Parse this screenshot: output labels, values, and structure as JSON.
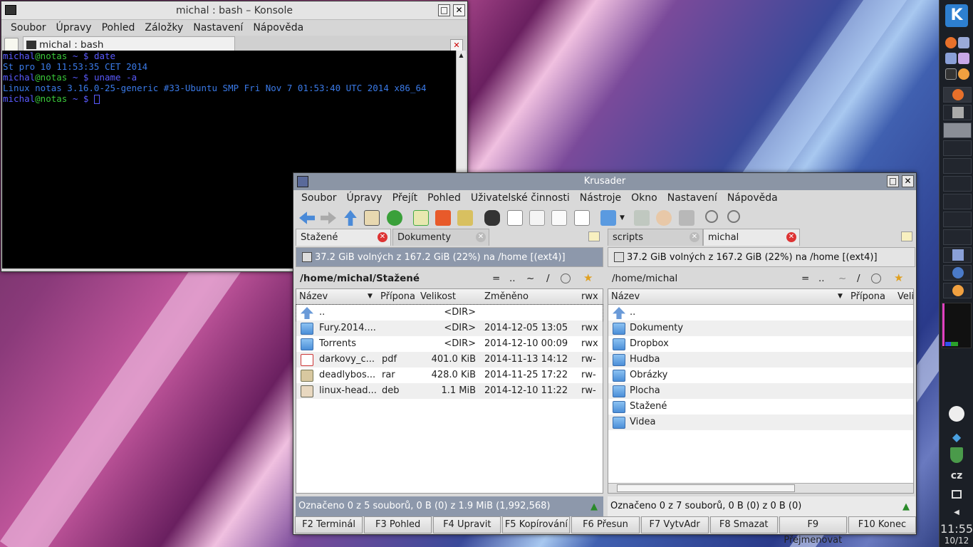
{
  "konsole": {
    "title": "michal : bash – Konsole",
    "menu": [
      "Soubor",
      "Úpravy",
      "Pohled",
      "Záložky",
      "Nastavení",
      "Nápověda"
    ],
    "tab": "michal : bash",
    "lines": [
      {
        "user": "michal",
        "host": "@notas",
        "rest": " ~ $ ",
        "cmd": "date"
      },
      {
        "out": "St pro 10 11:53:35 CET 2014"
      },
      {
        "user": "michal",
        "host": "@notas",
        "rest": " ~ $ ",
        "cmd": "uname -a"
      },
      {
        "out": "Linux notas 3.16.0-25-generic #33-Ubuntu SMP Fri Nov 7 01:53:40 UTC 2014 x86_64"
      },
      {
        "user": "michal",
        "host": "@notas",
        "rest": " ~ $ ",
        "cmd": ""
      }
    ]
  },
  "krusader": {
    "title": "Krusader",
    "menu": [
      "Soubor",
      "Úpravy",
      "Přejít",
      "Pohled",
      "Uživatelské činnosti",
      "Nástroje",
      "Okno",
      "Nastavení",
      "Nápověda"
    ],
    "left": {
      "tabs": [
        "Stažené",
        "Dokumenty"
      ],
      "space": "37.2 GiB volných z 167.2 GiB (22%) na /home [(ext4)]",
      "path": "/home/michal/Stažené",
      "path_buttons": [
        "=",
        "..",
        "~",
        "/"
      ],
      "headers": [
        "Název",
        "Přípona",
        "Velikost",
        "Změněno",
        "rwx"
      ],
      "rows": [
        {
          "name": "..",
          "ext": "",
          "size": "<DIR>",
          "date": "",
          "perm": "",
          "icon": "up"
        },
        {
          "name": "Fury.2014....",
          "ext": "",
          "size": "<DIR>",
          "date": "2014-12-05 13:05",
          "perm": "rwx",
          "icon": "folder"
        },
        {
          "name": "Torrents",
          "ext": "",
          "size": "<DIR>",
          "date": "2014-12-10 00:09",
          "perm": "rwx",
          "icon": "folder"
        },
        {
          "name": "darkovy_c...",
          "ext": "pdf",
          "size": "401.0 KiB",
          "date": "2014-11-13 14:12",
          "perm": "rw-",
          "icon": "pdf"
        },
        {
          "name": "deadlybos...",
          "ext": "rar",
          "size": "428.0 KiB",
          "date": "2014-11-25 17:22",
          "perm": "rw-",
          "icon": "rar"
        },
        {
          "name": "linux-head...",
          "ext": "deb",
          "size": "1.1 MiB",
          "date": "2014-12-10 11:22",
          "perm": "rw-",
          "icon": "deb"
        }
      ],
      "status": "Označeno 0 z 5 souborů, 0 B  (0) z 1.9 MiB (1,992,568)"
    },
    "right": {
      "tabs": [
        "scripts",
        "michal"
      ],
      "space": "37.2 GiB volných z 167.2 GiB (22%) na /home [(ext4)]",
      "path": "/home/michal",
      "path_buttons": [
        "=",
        "..",
        "~",
        "/"
      ],
      "headers": [
        "Název",
        "Přípona",
        "Veli"
      ],
      "rows": [
        {
          "name": "..",
          "icon": "up"
        },
        {
          "name": "Dokumenty",
          "icon": "folder"
        },
        {
          "name": "Dropbox",
          "icon": "folder"
        },
        {
          "name": "Hudba",
          "icon": "folder"
        },
        {
          "name": "Obrázky",
          "icon": "folder"
        },
        {
          "name": "Plocha",
          "icon": "folder"
        },
        {
          "name": "Stažené",
          "icon": "folder"
        },
        {
          "name": "Videa",
          "icon": "folder"
        }
      ],
      "status": "Označeno 0 z 7 souborů, 0 B  (0) z 0 B (0)"
    },
    "fkeys": [
      "F2 Terminál",
      "F3 Pohled",
      "F4 Upravit",
      "F5 Kopírování",
      "F6 Přesun",
      "F7 VytvAdr",
      "F8 Smazat",
      "F9 Přejmenovat",
      "F10 Konec"
    ]
  },
  "panel": {
    "kb_layout": "cz",
    "clock": "11:55",
    "date": "10/12"
  }
}
